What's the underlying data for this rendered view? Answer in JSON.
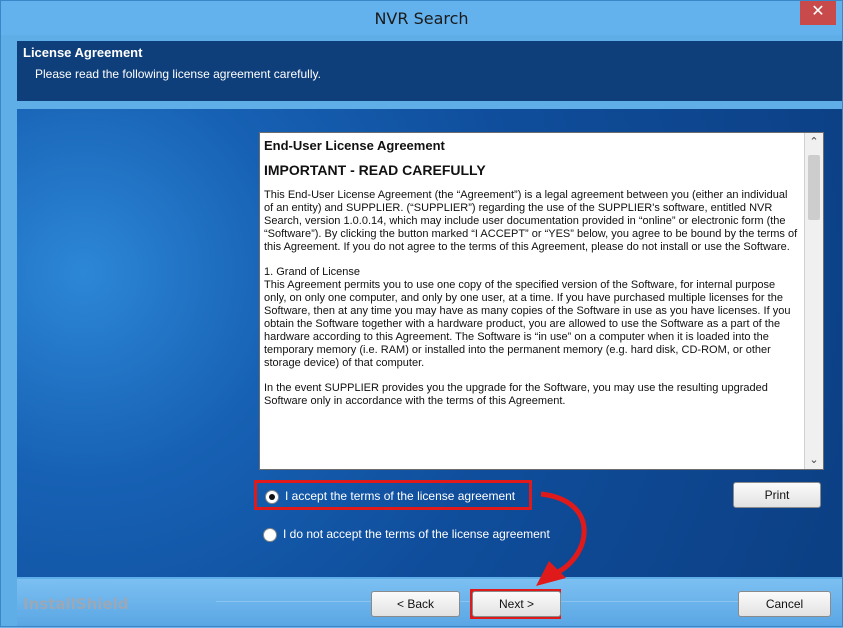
{
  "window": {
    "title": "NVR Search",
    "close_glyph": "✕"
  },
  "header": {
    "title": "License Agreement",
    "subtitle": "Please read the following license agreement carefully."
  },
  "eula": {
    "heading": "End-User License Agreement",
    "subheading": "IMPORTANT - READ CAREFULLY",
    "p1": "This End-User License Agreement (the “Agreement”) is a legal agreement between you (either an individual of an entity) and SUPPLIER. (“SUPPLIER”) regarding the use of the SUPPLIER's software, entitled NVR Search, version 1.0.0.14, which may include user documentation provided in “online” or electronic form (the “Software”). By clicking the button marked “I ACCEPT” or “YES” below, you agree to be bound by the terms of this Agreement. If you do not agree to the terms of this Agreement, please do not install or use the Software.",
    "p2_title": "1. Grand of License",
    "p2": "This Agreement permits you to use one copy of the specified version of the Software, for internal purpose only, on only one computer, and only by one user, at a time. If you have purchased multiple licenses for the Software, then at any time you may have as many copies of the Software in use as you have licenses. If you obtain the Software together with a hardware product, you are allowed to use the Software as a part of the hardware according to this Agreement. The Software is “in use” on a computer when it is loaded into the temporary memory (i.e. RAM) or installed into the permanent memory (e.g. hard disk, CD-ROM, or other storage device) of that computer.",
    "p3": "In the event SUPPLIER provides you the upgrade for the Software, you may use the resulting upgraded Software only in accordance with the terms of this Agreement."
  },
  "options": {
    "accept": "I accept the terms of the license agreement",
    "decline": "I do not accept the terms of the license agreement",
    "selected": "accept"
  },
  "buttons": {
    "print": "Print",
    "back": "< Back",
    "next": "Next >",
    "cancel": "Cancel"
  },
  "brand": {
    "name": "InstallShield"
  },
  "colors": {
    "highlight": "#e01a1a",
    "header_bg": "#0f3f7a"
  }
}
